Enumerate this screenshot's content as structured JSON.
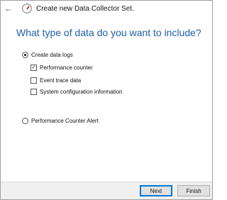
{
  "window": {
    "title": "Create new Data Collector Set.",
    "back_icon": "back-arrow-icon",
    "app_icon": "data-collector-icon"
  },
  "heading": "What type of data do you want to include?",
  "options": {
    "create_data_logs": {
      "label": "Create data logs",
      "selected": true
    },
    "performance_counter": {
      "label": "Performance counter",
      "checked": true
    },
    "event_trace_data": {
      "label": "Event trace data",
      "checked": false
    },
    "system_configuration": {
      "label": "System configuration information",
      "checked": false
    },
    "performance_counter_alert": {
      "label": "Performance Counter Alert",
      "selected": false
    }
  },
  "buttons": {
    "next": "Next",
    "finish": "Finish"
  },
  "colors": {
    "heading": "#1f5fa8",
    "footer": "#f0f0f0",
    "primary_border": "#0078d7"
  }
}
